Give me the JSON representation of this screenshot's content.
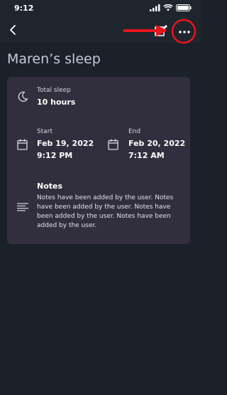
{
  "status_bar": {
    "time": "9:12"
  },
  "page": {
    "title": "Maren’s sleep"
  },
  "total_sleep": {
    "label": "Total sleep",
    "value": "10 hours"
  },
  "start": {
    "label": "Start",
    "date": "Feb 19, 2022",
    "time": "9:12 PM"
  },
  "end": {
    "label": "End",
    "date": "Feb 20, 2022",
    "time": "7:12 AM"
  },
  "notes": {
    "label": "Notes",
    "text": "Notes have been added by the user. Notes have been added by the user. Notes have been added by the user. Notes have been added by the user."
  },
  "icons": [
    "chevron-left-icon",
    "edit-icon",
    "more-icon",
    "moon-icon",
    "calendar-icon",
    "notes-icon"
  ],
  "colors": {
    "background": "#1b2129",
    "card": "#312f3d",
    "title": "#c9c7dc",
    "annotation": "#e8141c"
  }
}
